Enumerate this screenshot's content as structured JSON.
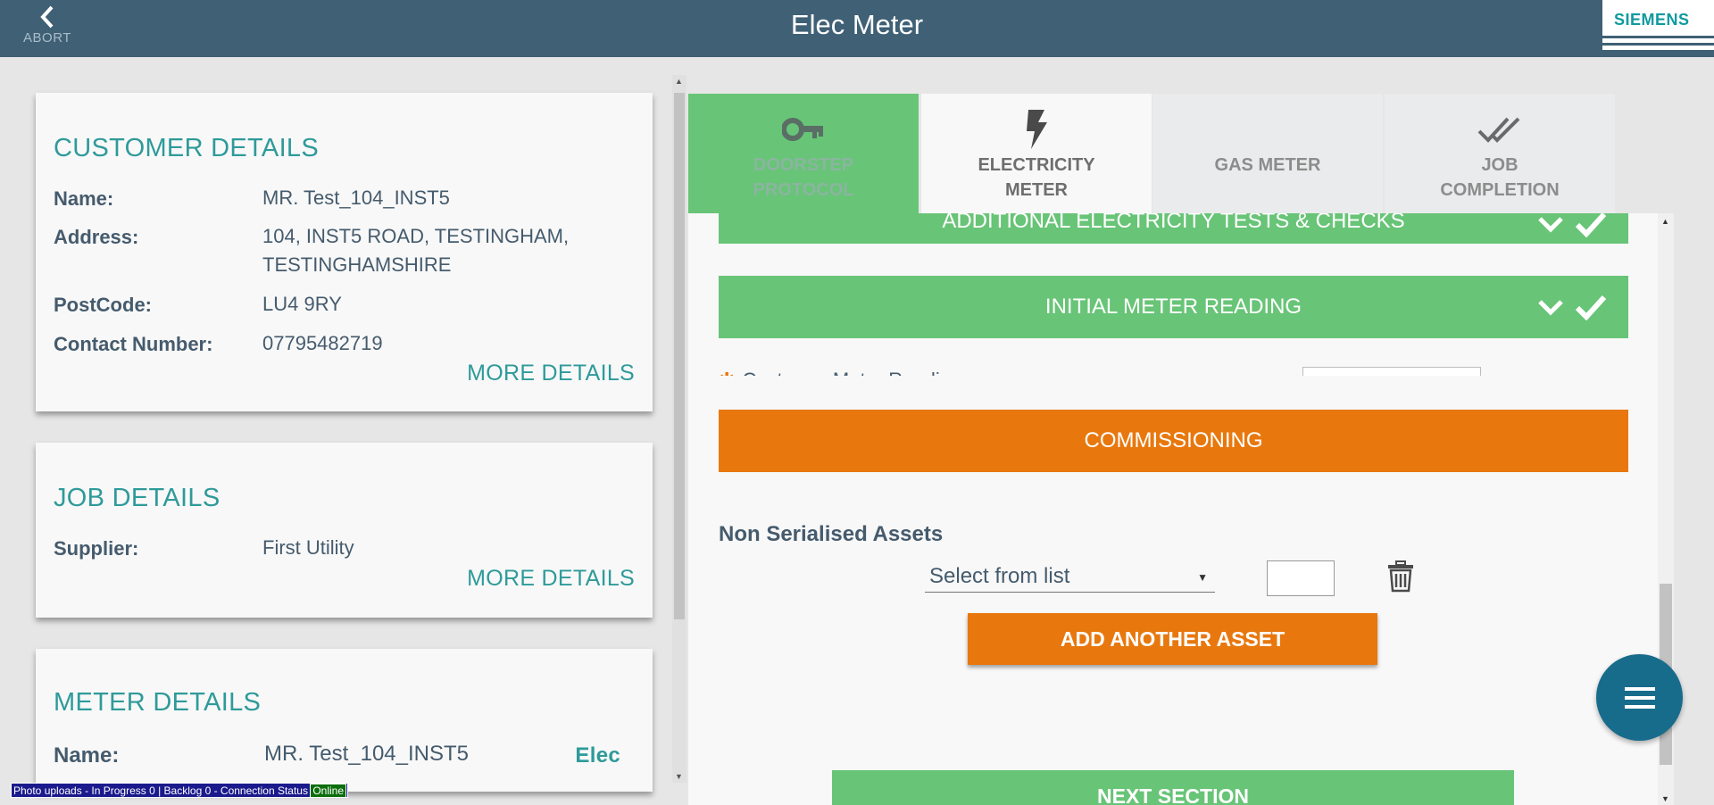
{
  "header": {
    "abort_label": "ABORT",
    "title": "Elec Meter",
    "logo": "SIEMENS"
  },
  "customer": {
    "heading": "CUSTOMER DETAILS",
    "name_label": "Name:",
    "name_value": "MR. Test_104_INST5",
    "address_label": "Address:",
    "address_value": "104, INST5 ROAD, TESTINGHAM, TESTINGHAMSHIRE",
    "postcode_label": "PostCode:",
    "postcode_value": "LU4 9RY",
    "contact_label": "Contact Number:",
    "contact_value": "07795482719",
    "more": "MORE DETAILS"
  },
  "job": {
    "heading": "JOB DETAILS",
    "supplier_label": "Supplier:",
    "supplier_value": "First Utility",
    "more": "MORE DETAILS"
  },
  "meter": {
    "heading": "METER DETAILS",
    "name_label": "Name:",
    "name_value": "MR. Test_104_INST5",
    "type": "Elec"
  },
  "status_bar": {
    "text": "Photo uploads - In Progress 0 | Backlog 0 - Connection Status",
    "connection": "Online"
  },
  "tabs": [
    {
      "line1": "DOORSTEP",
      "line2": "PROTOCOL",
      "icon": "key-icon"
    },
    {
      "line1": "ELECTRICITY",
      "line2": "METER",
      "icon": "lightning-icon"
    },
    {
      "line1": "GAS METER",
      "line2": "",
      "icon": "none"
    },
    {
      "line1": "JOB",
      "line2": "COMPLETION",
      "icon": "double-check-icon"
    }
  ],
  "sections": {
    "additional": "ADDITIONAL ELECTRICITY TESTS & CHECKS",
    "initial": "INITIAL METER READING",
    "partial_text": "Customer Meter Reading",
    "commissioning": "COMMISSIONING"
  },
  "assets": {
    "heading": "Non Serialised Assets",
    "select_value": "Select from list",
    "qty_value": "",
    "add_button": "ADD ANOTHER ASSET"
  },
  "next_button": "NEXT SECTION",
  "colors": {
    "header": "#3f6075",
    "teal": "#2f9a9a",
    "green": "#68c477",
    "orange": "#e8780e",
    "fab": "#176c8c"
  }
}
